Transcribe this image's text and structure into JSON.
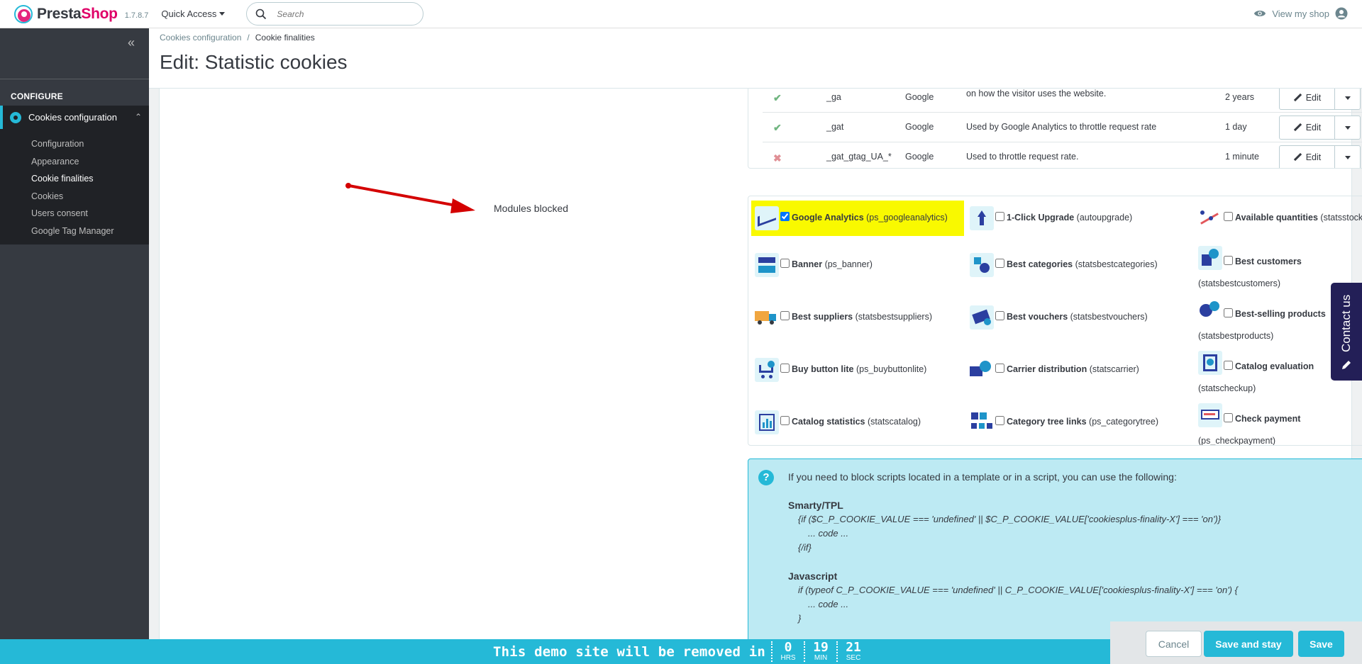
{
  "header": {
    "logo_prefix": "Presta",
    "logo_suffix": "Shop",
    "version": "1.7.8.7",
    "quick_access": "Quick Access",
    "search_placeholder": "Search",
    "view_shop": "View my shop"
  },
  "sidebar": {
    "section": "CONFIGURE",
    "active_item": "Cookies configuration",
    "sub_items": [
      "Configuration",
      "Appearance",
      "Cookie finalities",
      "Cookies",
      "Users consent",
      "Google Tag Manager"
    ],
    "current_sub": "Cookie finalities"
  },
  "page": {
    "breadcrumb_parent": "Cookies configuration",
    "breadcrumb_sep": "/",
    "breadcrumb_current": "Cookie finalities",
    "title": "Edit: Statistic cookies"
  },
  "cookies_table": {
    "edit_label": "Edit",
    "rows": [
      {
        "status": "✔",
        "name": "_ga",
        "provider": "Google",
        "description": "on how the visitor uses the website.",
        "expiry": "2 years"
      },
      {
        "status": "✔",
        "name": "_gat",
        "provider": "Google",
        "description": "Used by Google Analytics to throttle request rate",
        "expiry": "1 day"
      },
      {
        "status": "✖",
        "name": "_gat_gtag_UA_*",
        "provider": "Google",
        "description": "Used to throttle request rate.",
        "expiry": "1 minute"
      }
    ]
  },
  "modules": {
    "label": "Modules blocked",
    "items": [
      {
        "name": "Google Analytics",
        "tech": "(ps_googleanalytics)",
        "checked": true
      },
      {
        "name": "1-Click Upgrade",
        "tech": "(autoupgrade)",
        "checked": false
      },
      {
        "name": "Available quantities",
        "tech": "(statsstock)",
        "checked": false
      },
      {
        "name": "Banner",
        "tech": "(ps_banner)",
        "checked": false
      },
      {
        "name": "Best categories",
        "tech": "(statsbestcategories)",
        "checked": false
      },
      {
        "name": "Best customers",
        "tech": "(statsbestcustomers)",
        "checked": false
      },
      {
        "name": "Best suppliers",
        "tech": "(statsbestsuppliers)",
        "checked": false
      },
      {
        "name": "Best vouchers",
        "tech": "(statsbestvouchers)",
        "checked": false
      },
      {
        "name": "Best-selling products",
        "tech": "(statsbestproducts)",
        "checked": false
      },
      {
        "name": "Buy button lite",
        "tech": "(ps_buybuttonlite)",
        "checked": false
      },
      {
        "name": "Carrier distribution",
        "tech": "(statscarrier)",
        "checked": false
      },
      {
        "name": "Catalog evaluation",
        "tech": "(statscheckup)",
        "checked": false
      },
      {
        "name": "Catalog statistics",
        "tech": "(statscatalog)",
        "checked": false
      },
      {
        "name": "Category tree links",
        "tech": "(ps_categorytree)",
        "checked": false
      },
      {
        "name": "Check payment",
        "tech": "(ps_checkpayment)",
        "checked": false
      }
    ]
  },
  "info": {
    "intro": "If you need to block scripts located in a template or in a script, you can use the following:",
    "smarty_title": "Smarty/TPL",
    "smarty_line1": "{if ($C_P_COOKIE_VALUE === 'undefined' || $C_P_COOKIE_VALUE['cookiesplus-finality-X'] === 'on')}",
    "smarty_line2": "... code ...",
    "smarty_line3": "{/if}",
    "js_title": "Javascript",
    "js_line1": "if (typeof C_P_COOKIE_VALUE === 'undefined' || C_P_COOKIE_VALUE['cookiesplus-finality-X'] === 'on') {",
    "js_line2": "... code ...",
    "js_line3": "}"
  },
  "actions": {
    "cancel": "Cancel",
    "save_and_stay": "Save and stay",
    "save": "Save"
  },
  "contact": {
    "label": "Contact us"
  },
  "demo": {
    "message": "This demo site will be removed in",
    "hours": "0",
    "hours_label": "HRS",
    "minutes": "19",
    "minutes_label": "MIN",
    "seconds": "21",
    "seconds_label": "SEC"
  },
  "colors": {
    "accent": "#25b9d7",
    "sidebar": "#363a41",
    "highlight": "#f9f900",
    "arrow": "#d40000",
    "brand_pink": "#df0067"
  }
}
